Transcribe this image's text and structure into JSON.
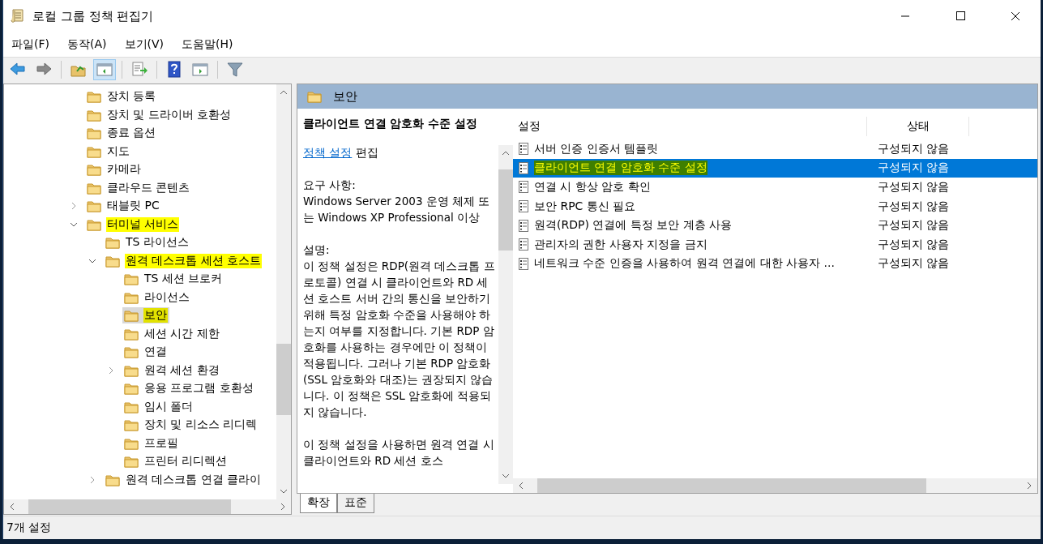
{
  "window": {
    "title": "로컬 그룹 정책 편집기"
  },
  "menu": [
    {
      "label": "파일(F)"
    },
    {
      "label": "동작(A)"
    },
    {
      "label": "보기(V)"
    },
    {
      "label": "도움말(H)"
    }
  ],
  "toolbar": [
    {
      "kind": "back",
      "pressed": false
    },
    {
      "kind": "forward",
      "pressed": false
    },
    {
      "kind": "sep"
    },
    {
      "kind": "up",
      "pressed": false
    },
    {
      "kind": "tree",
      "pressed": true
    },
    {
      "kind": "sep"
    },
    {
      "kind": "export",
      "pressed": false
    },
    {
      "kind": "sep"
    },
    {
      "kind": "help",
      "pressed": false
    },
    {
      "kind": "action",
      "pressed": false
    },
    {
      "kind": "sep"
    },
    {
      "kind": "filter",
      "pressed": false
    }
  ],
  "tree": [
    {
      "label": "장치 등록",
      "selected": false,
      "highlighted": false
    },
    {
      "label": "장치 및 드라이버 호환성",
      "selected": false,
      "highlighted": false
    },
    {
      "label": "종료 옵션",
      "selected": false,
      "highlighted": false
    },
    {
      "label": "지도",
      "selected": false,
      "highlighted": false
    },
    {
      "label": "카메라",
      "selected": false,
      "highlighted": false
    },
    {
      "label": "클라우드 콘텐츠",
      "selected": false,
      "highlighted": false
    },
    {
      "label": "태블릿 PC",
      "selected": false,
      "highlighted": false,
      "expanded": false
    },
    {
      "label": "터미널 서비스",
      "selected": false,
      "highlighted": true,
      "expanded": true,
      "children": [
        {
          "label": "TS 라이선스",
          "selected": false,
          "highlighted": false
        },
        {
          "label": "원격 데스크톱 세션 호스트",
          "selected": false,
          "highlighted": true,
          "expanded": true,
          "children": [
            {
              "label": "TS 세션 브로커",
              "selected": false,
              "highlighted": false
            },
            {
              "label": "라이선스",
              "selected": false,
              "highlighted": false
            },
            {
              "label": "보안",
              "selected": true,
              "highlighted": true
            },
            {
              "label": "세션 시간 제한",
              "selected": false,
              "highlighted": false
            },
            {
              "label": "연결",
              "selected": false,
              "highlighted": false
            },
            {
              "label": "원격 세션 환경",
              "selected": false,
              "highlighted": false,
              "expanded": false
            },
            {
              "label": "응용 프로그램 호환성",
              "selected": false,
              "highlighted": false
            },
            {
              "label": "임시 폴더",
              "selected": false,
              "highlighted": false
            },
            {
              "label": "장치 및 리소스 리디렉",
              "selected": false,
              "highlighted": false
            },
            {
              "label": "프로필",
              "selected": false,
              "highlighted": false
            },
            {
              "label": "프린터 리디렉션",
              "selected": false,
              "highlighted": false
            }
          ]
        },
        {
          "label": "원격 데스크톱 연결 클라이",
          "selected": false,
          "highlighted": false,
          "expanded": false
        }
      ]
    }
  ],
  "pane_header": {
    "title": "보안"
  },
  "description": {
    "title": "클라이언트 연결 암호화 수준 설정",
    "link": "정책 설정",
    "link_suffix": "편집",
    "paragraphs": [
      "요구 사항:\nWindows Server 2003 운영 체제 또는 Windows XP Professional 이상",
      "설명:\n이 정책 설정은 RDP(원격 데스크톱 프로토콜) 연결 시 클라이언트와 RD 세션 호스트 서버 간의 통신을 보안하기 위해 특정 암호화 수준을 사용해야 하는지 여부를 지정합니다. 기본 RDP 암호화를 사용하는 경우에만 이 정책이 적용됩니다. 그러나 기본 RDP 암호화(SSL 암호화와 대조)는 권장되지 않습니다. 이 정책은 SSL 암호화에 적용되지 않습니다.",
      "이 정책 설정을 사용하면 원격 연결 시 클라이언트와 RD 세션 호스"
    ]
  },
  "table": {
    "columns": [
      "설정",
      "상태"
    ],
    "rows": [
      {
        "name": "서버 인증 인증서 템플릿",
        "state": "구성되지 않음",
        "selected": false,
        "highlighted": false
      },
      {
        "name": "클라이언트 연결 암호화 수준 설정",
        "state": "구성되지 않음",
        "selected": true,
        "highlighted": true
      },
      {
        "name": "연결 시 항상 암호 확인",
        "state": "구성되지 않음",
        "selected": false,
        "highlighted": false
      },
      {
        "name": "보안 RPC 통신 필요",
        "state": "구성되지 않음",
        "selected": false,
        "highlighted": false
      },
      {
        "name": "원격(RDP) 연결에 특정 보안 계층 사용",
        "state": "구성되지 않음",
        "selected": false,
        "highlighted": false
      },
      {
        "name": "관리자의 권한 사용자 지정을 금지",
        "state": "구성되지 않음",
        "selected": false,
        "highlighted": false
      },
      {
        "name": "네트워크 수준 인증을 사용하여 원격 연결에 대한 사용자 ...",
        "state": "구성되지 않음",
        "selected": false,
        "highlighted": false
      }
    ]
  },
  "view_tabs": [
    {
      "label": "확장",
      "selected": true
    },
    {
      "label": "표준",
      "selected": false
    }
  ],
  "status_bar": {
    "text": "7개 설정"
  }
}
